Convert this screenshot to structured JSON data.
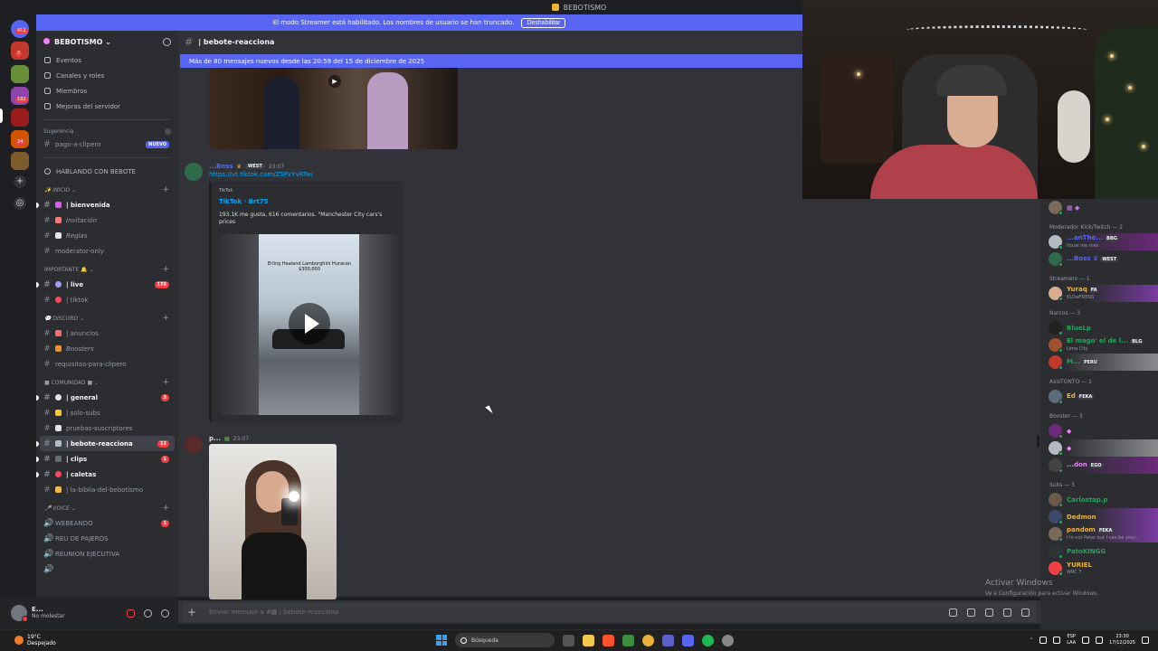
{
  "titlebar": {
    "title": "BEBOTISMO"
  },
  "banner": {
    "text": "El modo Streamer está habilitado. Los nombres de usuario se han truncado.",
    "button_label": "Deshabilitar"
  },
  "rail": {
    "badges": [
      "411",
      "3",
      "192",
      "24"
    ]
  },
  "server": {
    "name": "BEBOTISMO",
    "menu": [
      "Eventos",
      "Canales y roles",
      "Miembros",
      "Mejoras del servidor"
    ],
    "suggestion_label": "Sugerencia",
    "suggested_channel": "pago-a-clipero",
    "new_badge": "NUEVO",
    "hablando": "HABLANDO CON BEBOTE"
  },
  "categories": {
    "inicio": "INICIO",
    "importante": "IMPORTANTE",
    "discord": "DISCORD",
    "comunidad": "COMUNIDAD",
    "voice": "VOICE"
  },
  "channels": {
    "bienvenida": "| bienvenida",
    "invitacion": "Invitación",
    "reglas": "Reglas",
    "moderator": "moderator-only",
    "live": "| live",
    "live_count": "176",
    "tiktok": "| tiktok",
    "anuncios": "| anuncios",
    "boosters": "Boosters",
    "requisitos": "requisitos-para-clipero",
    "general": "| general",
    "general_count": "3",
    "solo_subs": "| solo-subs",
    "pruebas": "pruebas-suscriptores",
    "bebote": "| bebote-reacciona",
    "bebote_count": "12",
    "clips": "| clips",
    "clips_count": "1",
    "caletas": "| caletas",
    "biblia": "| la-biblia-del-bebotismo",
    "webeando": "WEBEANDO",
    "webeando_count": "1",
    "reu": "REU DE PAJEROS",
    "reunion": "REUNION EJECUTIVA"
  },
  "user": {
    "name": "E...",
    "status": "No molestar"
  },
  "chat": {
    "channel_title": "| bebote-reacciona",
    "new_messages_bar": "Más de 80 mensajes nuevos desde las 20:59 del 15 de diciembre de 2025",
    "msg1": {
      "username": "...Boss",
      "tag": "WEST",
      "time": "23:07",
      "link": "https://vt.tiktok.com/ZSPxYvRTw/",
      "embed_provider": "TikTok",
      "embed_title": "TikTok · Brt75",
      "embed_desc": "193.1K me gusta, 616 comentarios. \"Manchester City cars's prices",
      "overlay_text": "Erling Haaland Lamborghini Huracan $300,000"
    },
    "msg2": {
      "username": "p...",
      "time": "23:07"
    },
    "composer_placeholder": "Enviar mensaje a #",
    "composer_channel": "bebote-reacciona"
  },
  "members": {
    "groups": [
      {
        "label": "Moderador Kick/Twitch — 2"
      },
      {
        "label": "Streamers — 1"
      },
      {
        "label": "Narcos — 3"
      },
      {
        "label": "AsisTONTO — 1"
      },
      {
        "label": "Booster — 3"
      },
      {
        "label": "Subs — 5"
      }
    ],
    "mod1": {
      "name": "...anThe...",
      "sub": "Itsual me mex",
      "tag": "BBG"
    },
    "mod2": {
      "name": "...Boss",
      "tag": "WEST"
    },
    "streamer": {
      "name": "Yuraq",
      "sub": "KLOwFRENS",
      "tag": "FA"
    },
    "narco1": {
      "name": "BlueLp"
    },
    "narco2": {
      "name": "El mago' el de l...",
      "sub": "Lima City",
      "tag": "BLG"
    },
    "narco3": {
      "name": "M...",
      "tag": "PERU"
    },
    "asis": {
      "name": "Ed",
      "tag": "FEKA"
    },
    "booster3": {
      "name": "...don",
      "tag": "EGO"
    },
    "sub1": {
      "name": "Carlostap.p"
    },
    "sub2": {
      "name": "Dedmon"
    },
    "sub3": {
      "name": "pandom",
      "sub": "I'm not Peter but I can be your...",
      "tag": "FEKA"
    },
    "sub4": {
      "name": "PatoKINGG"
    },
    "sub5": {
      "name": "YURIEL",
      "sub": "WRC 7"
    }
  },
  "watermark": {
    "title": "Activar Windows",
    "sub": "Ve a Configuración para activar Windows."
  },
  "taskbar": {
    "temp": "19°C",
    "weather": "Despejado",
    "search": "Búsqueda",
    "lang1": "ESP",
    "lang2": "LAA",
    "time": "23:30",
    "date": "17/12/2025"
  },
  "colors": {
    "accent": "#5865f2",
    "link": "#00a8fc",
    "danger": "#f23f43",
    "online": "#23a55a"
  }
}
